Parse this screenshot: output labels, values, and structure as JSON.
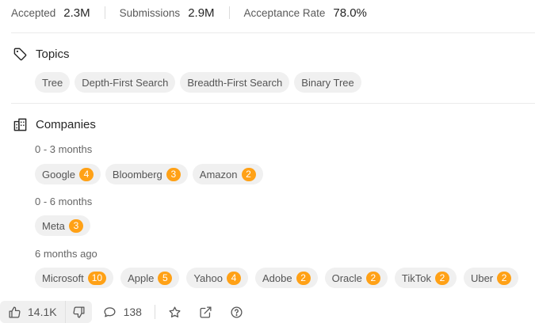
{
  "stats": {
    "accepted_label": "Accepted",
    "accepted_value": "2.3M",
    "submissions_label": "Submissions",
    "submissions_value": "2.9M",
    "acceptance_label": "Acceptance Rate",
    "acceptance_value": "78.0%"
  },
  "topics": {
    "title": "Topics",
    "tags": [
      "Tree",
      "Depth-First Search",
      "Breadth-First Search",
      "Binary Tree"
    ]
  },
  "companies": {
    "title": "Companies",
    "groups": [
      {
        "period": "0 - 3 months",
        "items": [
          {
            "name": "Google",
            "count": "4"
          },
          {
            "name": "Bloomberg",
            "count": "3"
          },
          {
            "name": "Amazon",
            "count": "2"
          }
        ]
      },
      {
        "period": "0 - 6 months",
        "items": [
          {
            "name": "Meta",
            "count": "3"
          }
        ]
      },
      {
        "period": "6 months ago",
        "items": [
          {
            "name": "Microsoft",
            "count": "10"
          },
          {
            "name": "Apple",
            "count": "5"
          },
          {
            "name": "Yahoo",
            "count": "4"
          },
          {
            "name": "Adobe",
            "count": "2"
          },
          {
            "name": "Oracle",
            "count": "2"
          },
          {
            "name": "TikTok",
            "count": "2"
          },
          {
            "name": "Uber",
            "count": "2"
          }
        ]
      }
    ]
  },
  "footer": {
    "likes": "14.1K",
    "comments": "138"
  },
  "colors": {
    "accent": "#ffa116",
    "chip_bg": "#f0f0f0"
  }
}
